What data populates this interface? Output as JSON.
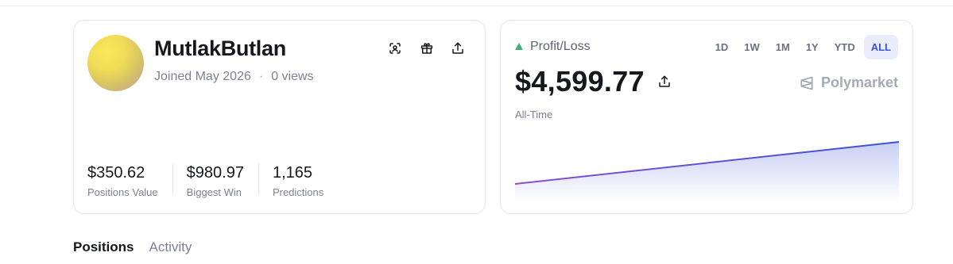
{
  "profile": {
    "username": "MutlakButlan",
    "joined": "Joined May 2026",
    "separator": "·",
    "views": "0 views",
    "icons": [
      "scan-face-icon",
      "gift-icon",
      "share-icon"
    ],
    "stats": [
      {
        "value": "$350.62",
        "label": "Positions Value"
      },
      {
        "value": "$980.97",
        "label": "Biggest Win"
      },
      {
        "value": "1,165",
        "label": "Predictions"
      }
    ]
  },
  "pnl": {
    "title": "Profit/Loss",
    "trend_color": "#3cb371",
    "ranges": [
      "1D",
      "1W",
      "1M",
      "1Y",
      "YTD",
      "ALL"
    ],
    "active_range": "ALL",
    "amount": "$4,599.77",
    "brand": "Polymarket",
    "period": "All-Time",
    "line_color_start": "#8a4fd0",
    "line_color_end": "#3a52d4"
  },
  "chart_data": {
    "type": "area",
    "title": "",
    "xlabel": "",
    "ylabel": "",
    "x": [
      0,
      1
    ],
    "values": [
      0,
      1
    ]
  },
  "tabs": [
    {
      "label": "Positions",
      "active": true
    },
    {
      "label": "Activity",
      "active": false
    }
  ]
}
